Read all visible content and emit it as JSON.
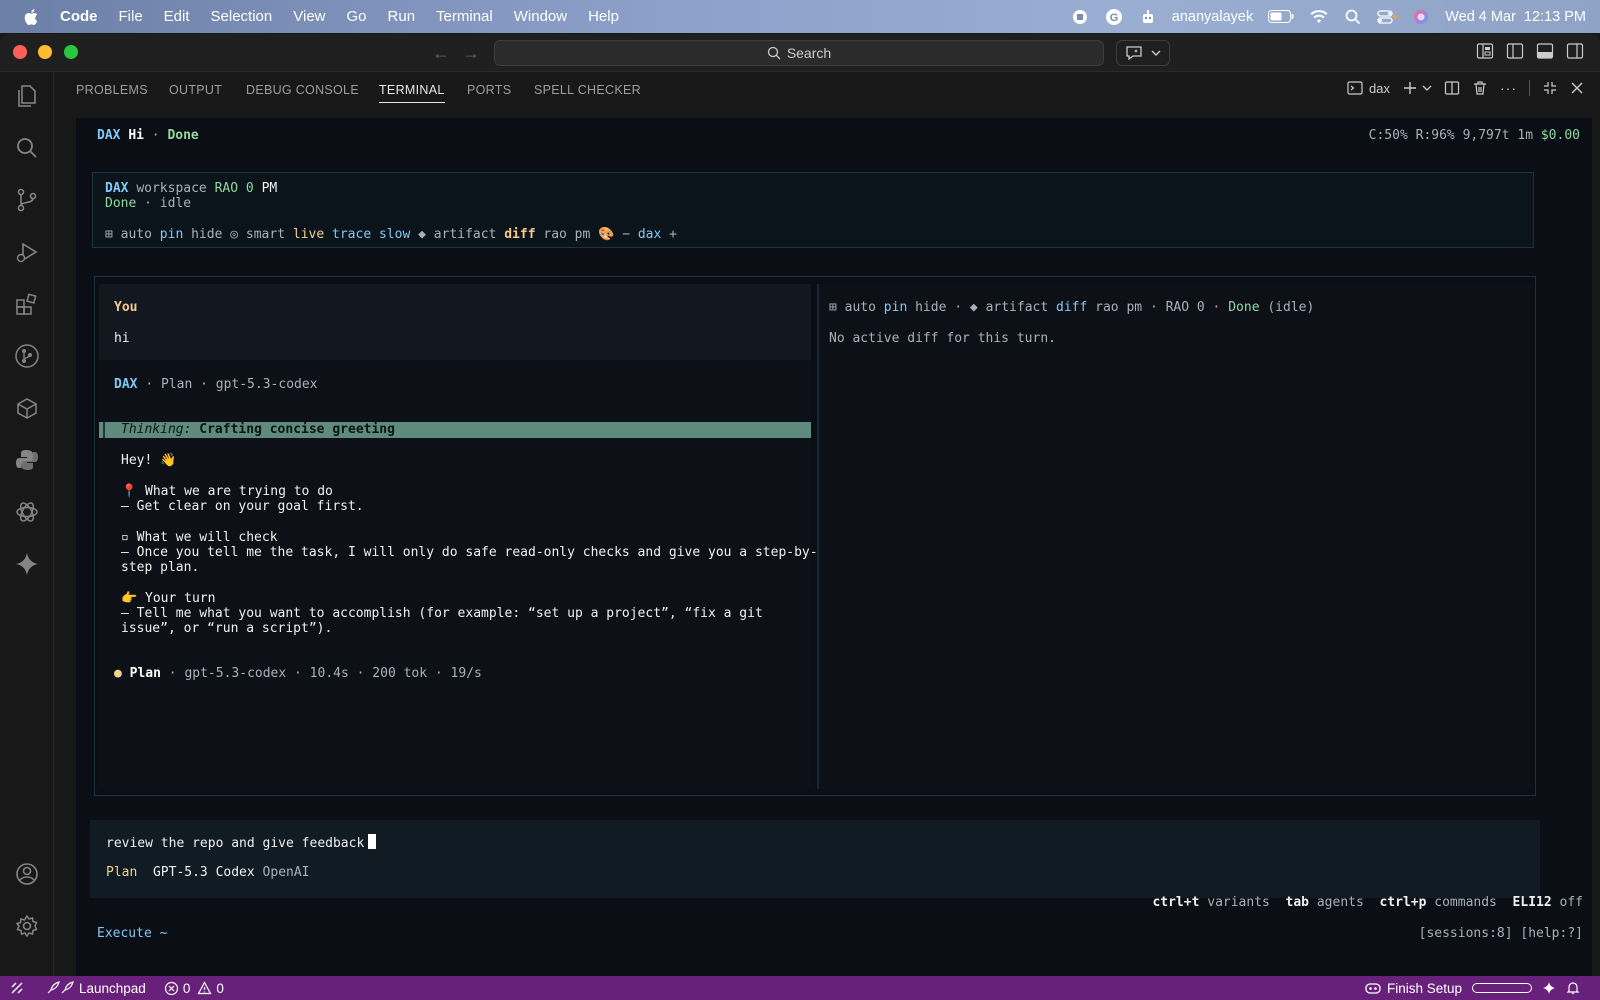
{
  "menubar": {
    "app_name": "Code",
    "items": [
      "File",
      "Edit",
      "Selection",
      "View",
      "Go",
      "Run",
      "Terminal",
      "Window",
      "Help"
    ],
    "user": "ananyalayek",
    "datetime": "Wed 4 Mar  12:13 PM"
  },
  "titlebar": {
    "search_placeholder": "Search"
  },
  "panel": {
    "tabs": [
      "PROBLEMS",
      "OUTPUT",
      "DEBUG CONSOLE",
      "TERMINAL",
      "PORTS",
      "SPELL CHECKER"
    ],
    "active_tab": "TERMINAL",
    "terminal_name": "dax"
  },
  "terminal": {
    "top": {
      "app": "DAX",
      "greeting": "Hi",
      "sep": "·",
      "state": "Done",
      "stats": "C:50% R:96% 9,797t 1m",
      "cost": "$0.00"
    },
    "header": {
      "l1_app": "DAX",
      "l1_workspace": "workspace",
      "l1_rao": "RAO",
      "l1_zero": "0",
      "l1_pm": "PM",
      "l2_done": "Done",
      "l2_rest": "· idle",
      "opt_grid": "⊞",
      "opt_auto": "auto",
      "opt_pin": "pin",
      "opt_hide": "hide",
      "opt_circle": "◎",
      "opt_smart": "smart",
      "opt_live": "live",
      "opt_trace": "trace",
      "opt_slow": "slow",
      "opt_diamond": "◆",
      "opt_artifact": "artifact",
      "opt_diff": "diff",
      "opt_raopm": "rao pm",
      "opt_palette": "🎨",
      "opt_dash": "−",
      "opt_dax": "dax",
      "opt_plus": "+"
    },
    "chat": {
      "you_label": "You",
      "you_msg": "hi",
      "assistant": "DAX",
      "assistant_meta": "· Plan · gpt-5.3-codex",
      "thinking_label": "Thinking:",
      "thinking_text": "Crafting concise greeting",
      "reply": [
        "Hey! 👋",
        "",
        "📍 What we are trying to do",
        "– Get clear on your goal first.",
        "",
        "▫ What we will check",
        "– Once you tell me the task, I will only do safe read-only checks and give you a step-by-",
        "step plan.",
        "",
        "👉 Your turn",
        "– Tell me what you want to accomplish (for example: “set up a project”, “fix a git",
        "issue”, or “run a script”)."
      ],
      "footer_dot": "●",
      "footer_mode": "Plan",
      "footer_meta": "· gpt-5.3-codex · 10.4s · 200 tok · 19/s"
    },
    "right": {
      "bar_grid": "⊞",
      "bar_auto": "auto",
      "bar_pin": "pin",
      "bar_hide": "hide ·",
      "bar_diamond": "◆",
      "bar_artifact": "artifact",
      "bar_diff": "diff",
      "bar_raopm": "rao pm · RAO 0 ·",
      "bar_done": "Done",
      "bar_idle": "(idle)",
      "empty": "No active diff for this turn."
    },
    "input": {
      "value": "review the repo and give feedback",
      "mode": "Plan",
      "model": "GPT-5.3 Codex",
      "provider": "OpenAI"
    },
    "hints": {
      "k1": "ctrl+t",
      "v1": "variants",
      "k2": "tab",
      "v2": "agents",
      "k3": "ctrl+p",
      "v3": "commands",
      "k4": "ELI12",
      "v4": "off"
    },
    "bottom": {
      "execute": "Execute ~",
      "sessions": "[sessions:8] [help:?]"
    }
  },
  "statusbar": {
    "launchpad": "Launchpad",
    "errors": "0",
    "warnings": "0",
    "finish_setup": "Finish Setup"
  },
  "colors": {
    "statusbar": "#68217a",
    "accent_blue": "#82c8f4",
    "accent_green": "#8fd8a0",
    "thinking_bar": "#5e8b7e"
  }
}
